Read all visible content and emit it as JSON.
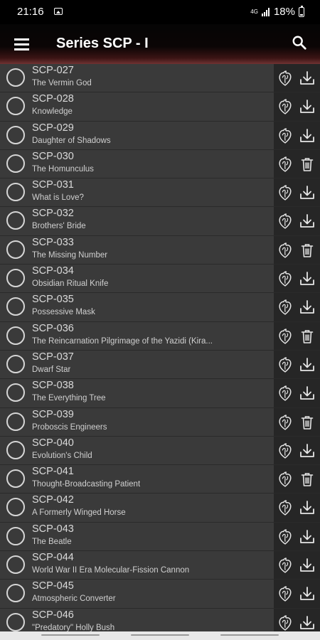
{
  "status": {
    "time": "21:16",
    "network": "4G",
    "battery": "18%"
  },
  "app_bar": {
    "title": "Series SCP - I",
    "menu_icon": "menu-icon",
    "search_icon": "search-icon"
  },
  "items": [
    {
      "id": "SCP-027",
      "name": "The Vermin God",
      "action": "download"
    },
    {
      "id": "SCP-028",
      "name": "Knowledge",
      "action": "download"
    },
    {
      "id": "SCP-029",
      "name": "Daughter of Shadows",
      "action": "download"
    },
    {
      "id": "SCP-030",
      "name": "The Homunculus",
      "action": "delete"
    },
    {
      "id": "SCP-031",
      "name": "What is Love?",
      "action": "download"
    },
    {
      "id": "SCP-032",
      "name": "Brothers' Bride",
      "action": "download"
    },
    {
      "id": "SCP-033",
      "name": "The Missing Number",
      "action": "delete"
    },
    {
      "id": "SCP-034",
      "name": "Obsidian Ritual Knife",
      "action": "download"
    },
    {
      "id": "SCP-035",
      "name": "Possessive Mask",
      "action": "download"
    },
    {
      "id": "SCP-036",
      "name": "The Reincarnation Pilgrimage of the Yazidi (Kira...",
      "action": "delete"
    },
    {
      "id": "SCP-037",
      "name": "Dwarf Star",
      "action": "download"
    },
    {
      "id": "SCP-038",
      "name": "The Everything Tree",
      "action": "download"
    },
    {
      "id": "SCP-039",
      "name": "Proboscis Engineers",
      "action": "delete"
    },
    {
      "id": "SCP-040",
      "name": "Evolution's Child",
      "action": "download"
    },
    {
      "id": "SCP-041",
      "name": "Thought-Broadcasting Patient",
      "action": "delete"
    },
    {
      "id": "SCP-042",
      "name": "A Formerly Winged Horse",
      "action": "download"
    },
    {
      "id": "SCP-043",
      "name": "The Beatle",
      "action": "download"
    },
    {
      "id": "SCP-044",
      "name": "World War II Era Molecular-Fission Cannon",
      "action": "download"
    },
    {
      "id": "SCP-045",
      "name": "Atmospheric Converter",
      "action": "download"
    },
    {
      "id": "SCP-046",
      "name": "\"Predatory\" Holly Bush",
      "action": "download"
    }
  ]
}
